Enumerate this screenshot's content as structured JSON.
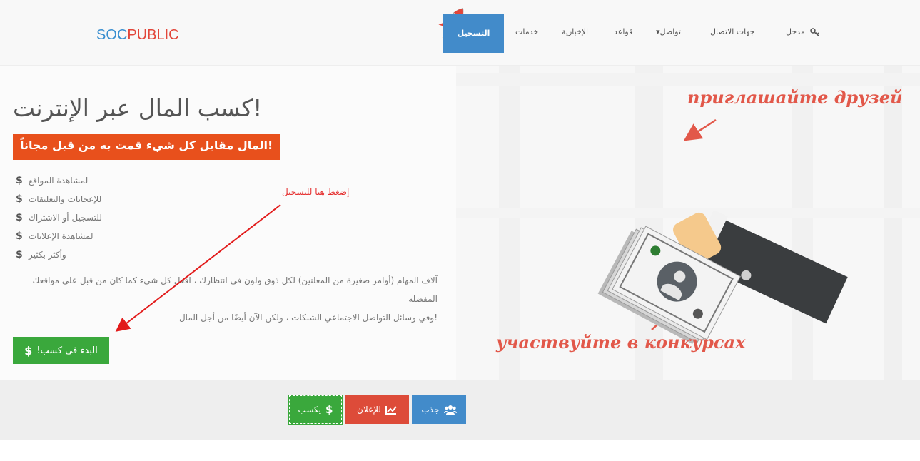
{
  "header": {
    "logo_soc": "SOC",
    "logo_public": "PUBLIC",
    "nav": {
      "login": "مدخل",
      "contacts": "جهات الاتصال",
      "social": "تواصل",
      "rules": "قواعد",
      "news": "الإخبارية",
      "services": "خدمات",
      "register": "التسجيل"
    }
  },
  "hero": {
    "title": "!كسب المال عبر الإنترنت",
    "banner": "!المال مقابل كل شيء قمت به من قبل مجاناً",
    "benefits": [
      "لمشاهدة المواقع",
      "للإعجابات والتعليقات",
      "للتسجيل أو الاشتراك",
      "لمشاهدة الإعلانات",
      "وأكثر بكثير"
    ],
    "description_line1": "آلاف المهام (أوامر صغيرة من المعلنين) لكل ذوق ولون في انتظارك ، افعل كل شيء كما كان من قبل على مواقعك المفضلة",
    "description_line2": "!وفي وسائل التواصل الاجتماعي الشبكات ، ولكن الآن أيضًا من أجل المال",
    "start_button": "!البدء في كسب",
    "annotation": "إضغط هنا للتسجيل",
    "ru_top": "приглашайте друзей",
    "ru_bottom": "участвуйте в конкурсах"
  },
  "tabs": {
    "earn": "يكسب",
    "advertise": "للإعلان",
    "attract": "جذب"
  },
  "colors": {
    "primary": "#428bca",
    "success": "#3aa83c",
    "danger": "#dd4b39",
    "banner": "#e8501c"
  }
}
